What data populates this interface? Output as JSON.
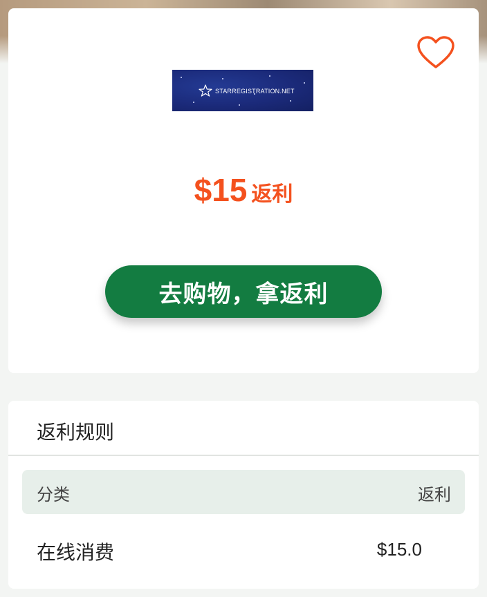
{
  "offer": {
    "brand_logo_text": "STARREGISTRATION.NET",
    "cashback_amount": "$15",
    "cashback_suffix": "返利",
    "shop_button_label": "去购物，拿返利"
  },
  "rules": {
    "title": "返利规则",
    "header": {
      "category": "分类",
      "cashback": "返利"
    },
    "rows": [
      {
        "category": "在线消费",
        "value": "$15.0"
      }
    ]
  },
  "icons": {
    "favorite": "heart-outline-icon",
    "logo_star": "star-icon"
  },
  "colors": {
    "accent_orange": "#f4511e",
    "button_green": "#137c41",
    "header_bg": "#e7efea",
    "logo_navy": "#1b2a7a"
  }
}
